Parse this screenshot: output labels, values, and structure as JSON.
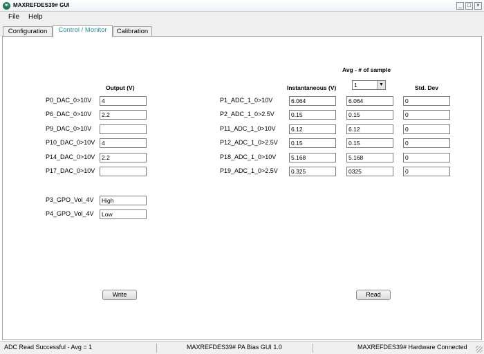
{
  "window": {
    "title": "MAXREFDES39# GUI",
    "icon_label": "m",
    "minimize": "_",
    "maximize": "□",
    "close": "×"
  },
  "menu": {
    "file": "File",
    "help": "Help"
  },
  "tabs": [
    {
      "label": "Configuration"
    },
    {
      "label": "Control / Monitor",
      "active": true
    },
    {
      "label": "Calibration"
    }
  ],
  "output": {
    "header": "Output (V)",
    "rows": [
      {
        "label": "P0_DAC_0>10V",
        "value": "4"
      },
      {
        "label": "P6_DAC_0>10V",
        "value": "2.2"
      },
      {
        "label": "P9_DAC_0>10V",
        "value": ""
      },
      {
        "label": "P10_DAC_0>10V",
        "value": "4"
      },
      {
        "label": "P14_DAC_0>10V",
        "value": "2.2"
      },
      {
        "label": "P17_DAC_0>10V",
        "value": ""
      }
    ],
    "gpo": [
      {
        "label": "P3_GPO_Vol_4V",
        "value": "High"
      },
      {
        "label": "P4_GPO_Vol_4V",
        "value": "Low"
      }
    ],
    "write_button": "Write"
  },
  "adc": {
    "avg_header": "Avg - # of sample",
    "avg_value": "1",
    "instantaneous_header": "Instantaneous (V)",
    "stddev_header": "Std. Dev",
    "rows": [
      {
        "label": "P1_ADC_1_0>10V",
        "inst": "6.064",
        "avg": "6.064",
        "std": "0"
      },
      {
        "label": "P2_ADC_1_0>2.5V",
        "inst": "0.15",
        "avg": "0.15",
        "std": "0"
      },
      {
        "label": "P11_ADC_1_0>10V",
        "inst": "6.12",
        "avg": "6.12",
        "std": "0"
      },
      {
        "label": "P12_ADC_1_0>2.5V",
        "inst": "0.15",
        "avg": "0.15",
        "std": "0"
      },
      {
        "label": "P18_ADC_1_0>10V",
        "inst": "5.168",
        "avg": "5.168",
        "std": "0"
      },
      {
        "label": "P19_ADC_1_0>2.5V",
        "inst": "0.325",
        "avg": "0325",
        "std": "0"
      }
    ],
    "read_button": "Read"
  },
  "status": {
    "left": "ADC Read Successful - Avg = 1",
    "center": "MAXREFDES39# PA Bias GUI 1.0",
    "right": "MAXREFDES39# Hardware Connected"
  },
  "colors": {
    "active_tab_text": "#2a8fa8",
    "app_icon": "#1f7a5a"
  }
}
